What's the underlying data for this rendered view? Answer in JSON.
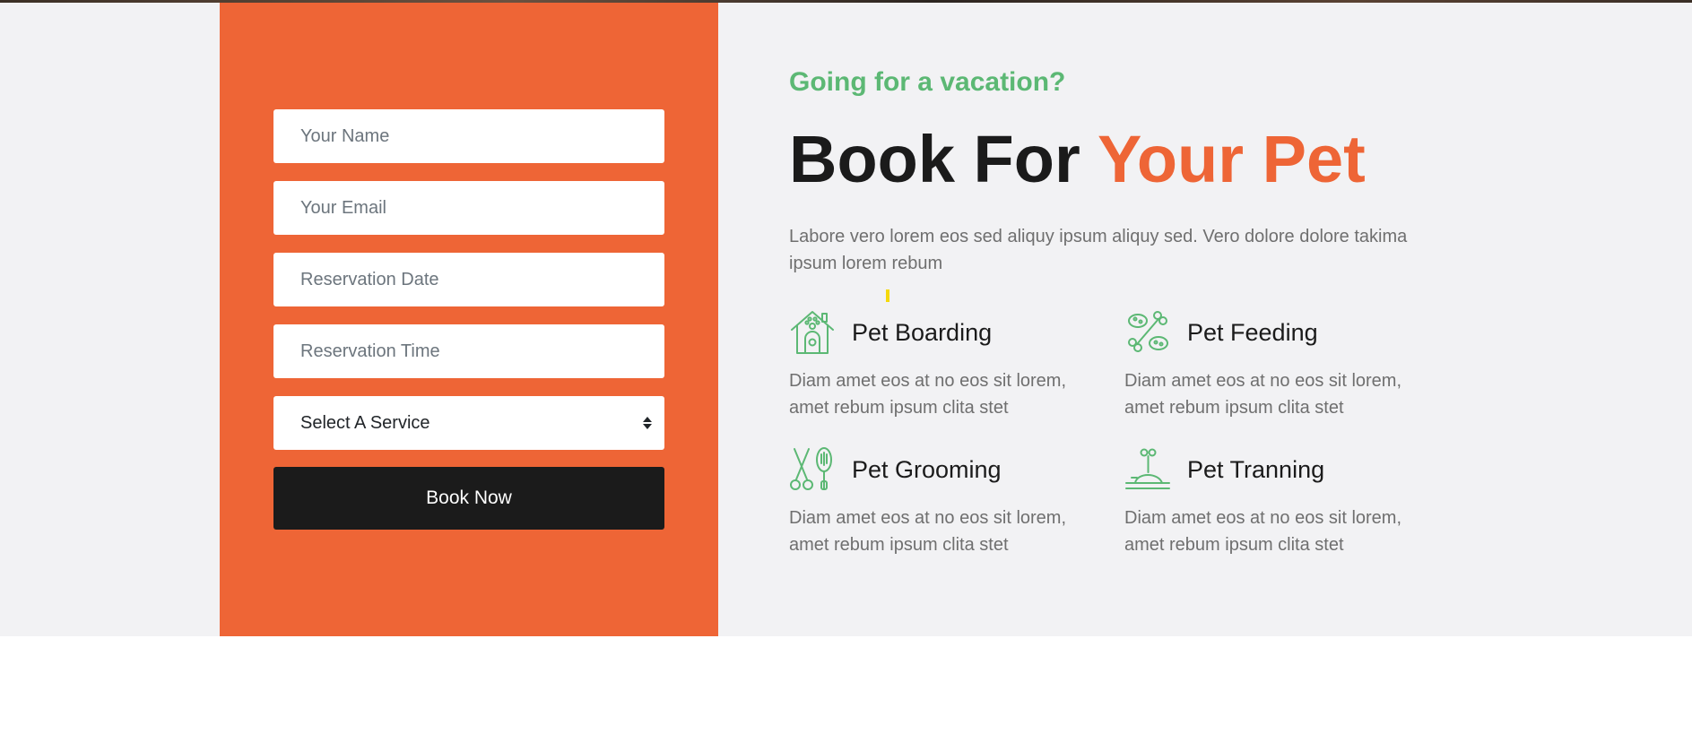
{
  "form": {
    "name_placeholder": "Your Name",
    "email_placeholder": "Your Email",
    "date_placeholder": "Reservation Date",
    "time_placeholder": "Reservation Time",
    "service_selected": "Select A Service",
    "submit_label": "Book Now"
  },
  "intro": {
    "subtitle": "Going for a vacation?",
    "title_main": "Book For ",
    "title_accent": "Your Pet",
    "description": "Labore vero lorem eos sed aliquy ipsum aliquy sed. Vero dolore dolore takima ipsum lorem rebum"
  },
  "services": [
    {
      "icon": "pet-house-icon",
      "title": "Pet Boarding",
      "description": "Diam amet eos at no eos sit lorem, amet rebum ipsum clita stet"
    },
    {
      "icon": "pet-food-bone-icon",
      "title": "Pet Feeding",
      "description": "Diam amet eos at no eos sit lorem, amet rebum ipsum clita stet"
    },
    {
      "icon": "scissors-brush-icon",
      "title": "Pet Grooming",
      "description": "Diam amet eos at no eos sit lorem, amet rebum ipsum clita stet"
    },
    {
      "icon": "training-icon",
      "title": "Pet Tranning",
      "description": "Diam amet eos at no eos sit lorem, amet rebum ipsum clita stet"
    }
  ],
  "colors": {
    "accent": "#ee6536",
    "green": "#5cb874",
    "dark": "#1b1b1b",
    "section_bg": "#f2f2f4"
  }
}
